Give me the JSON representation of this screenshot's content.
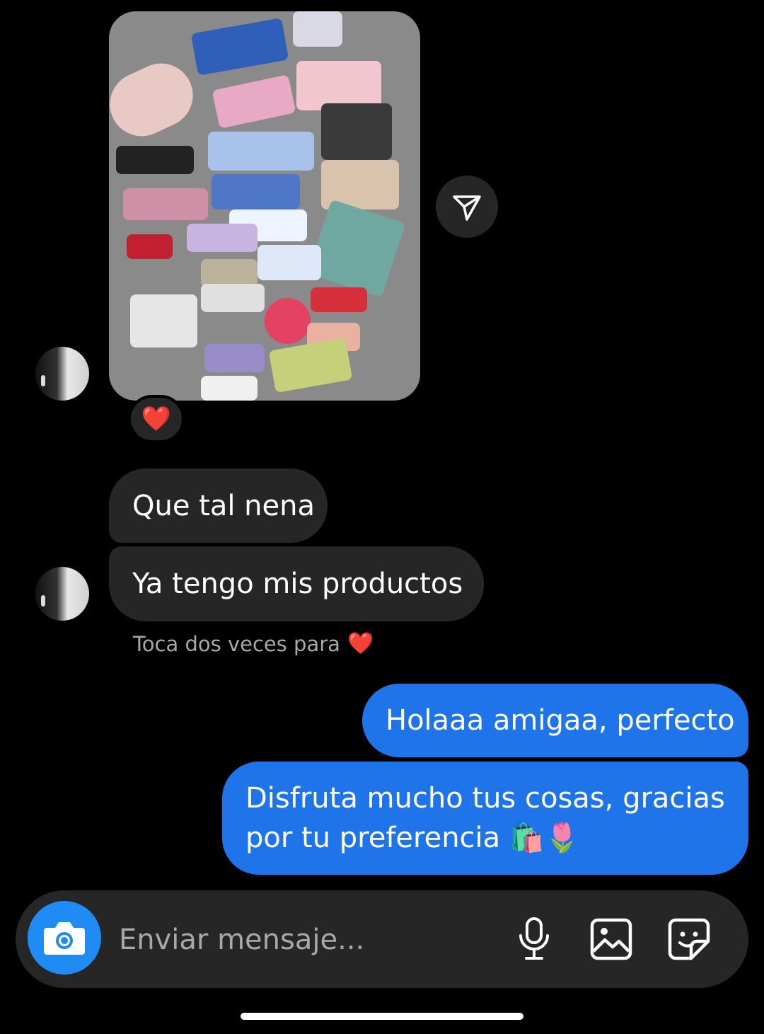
{
  "thread": {
    "photo_alt": "Foto",
    "reaction_emoji": "❤️",
    "incoming": [
      {
        "text": "Que tal nena"
      },
      {
        "text": "Ya tengo mis productos"
      }
    ],
    "hint": {
      "text": "Toca dos veces para",
      "emoji": "❤️"
    },
    "outgoing": [
      {
        "text": "Holaaa amigaa, perfecto"
      },
      {
        "text": "Disfruta mucho tus cosas, gracias por tu preferencia 🛍️🌷"
      }
    ]
  },
  "composer": {
    "placeholder": "Enviar mensaje...",
    "icons": [
      "camera-icon",
      "microphone-icon",
      "gallery-icon",
      "sticker-icon"
    ]
  },
  "colors": {
    "outgoing_bubble": "#1f74ea",
    "incoming_bubble": "#262626",
    "camera_button": "#1f8cf5",
    "background": "#000000"
  }
}
